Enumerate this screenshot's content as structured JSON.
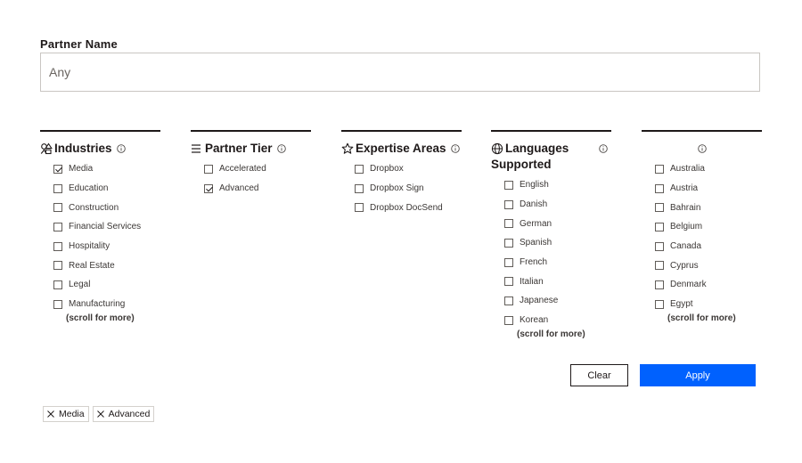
{
  "partner_name": {
    "label": "Partner Name",
    "placeholder": "Any"
  },
  "filters": {
    "industries": {
      "title": "Industries",
      "icon": "shapes-icon",
      "options": [
        {
          "label": "Media",
          "checked": true
        },
        {
          "label": "Education",
          "checked": false
        },
        {
          "label": "Construction",
          "checked": false
        },
        {
          "label": "Financial Services",
          "checked": false
        },
        {
          "label": "Hospitality",
          "checked": false
        },
        {
          "label": "Real Estate",
          "checked": false
        },
        {
          "label": "Legal",
          "checked": false
        },
        {
          "label": "Manufacturing",
          "checked": false
        }
      ],
      "more": "(scroll for more)"
    },
    "partner_tier": {
      "title": "Partner Tier",
      "icon": "list-icon",
      "options": [
        {
          "label": "Accelerated",
          "checked": false
        },
        {
          "label": "Advanced",
          "checked": true
        }
      ]
    },
    "expertise_areas": {
      "title": "Expertise Areas",
      "icon": "star-icon",
      "options": [
        {
          "label": "Dropbox",
          "checked": false
        },
        {
          "label": "Dropbox Sign",
          "checked": false
        },
        {
          "label": "Dropbox DocSend",
          "checked": false
        }
      ]
    },
    "languages": {
      "title_line1": "Languages",
      "title_line2": "Supported",
      "icon": "globe-icon",
      "options": [
        {
          "label": "English",
          "checked": false
        },
        {
          "label": "Danish",
          "checked": false
        },
        {
          "label": "German",
          "checked": false
        },
        {
          "label": "Spanish",
          "checked": false
        },
        {
          "label": "French",
          "checked": false
        },
        {
          "label": "Italian",
          "checked": false
        },
        {
          "label": "Japanese",
          "checked": false
        },
        {
          "label": "Korean",
          "checked": false
        }
      ],
      "more": "(scroll for more)"
    },
    "countries": {
      "title": "",
      "options": [
        {
          "label": "Australia",
          "checked": false
        },
        {
          "label": "Austria",
          "checked": false
        },
        {
          "label": "Bahrain",
          "checked": false
        },
        {
          "label": "Belgium",
          "checked": false
        },
        {
          "label": "Canada",
          "checked": false
        },
        {
          "label": "Cyprus",
          "checked": false
        },
        {
          "label": "Denmark",
          "checked": false
        },
        {
          "label": "Egypt",
          "checked": false
        }
      ],
      "more": "(scroll for more)"
    }
  },
  "actions": {
    "clear_label": "Clear",
    "apply_label": "Apply"
  },
  "active_filters": [
    {
      "label": "Media"
    },
    {
      "label": "Advanced"
    }
  ],
  "colors": {
    "accent": "#0061fe",
    "text": "#1e1919",
    "border": "#c9c6c2"
  }
}
